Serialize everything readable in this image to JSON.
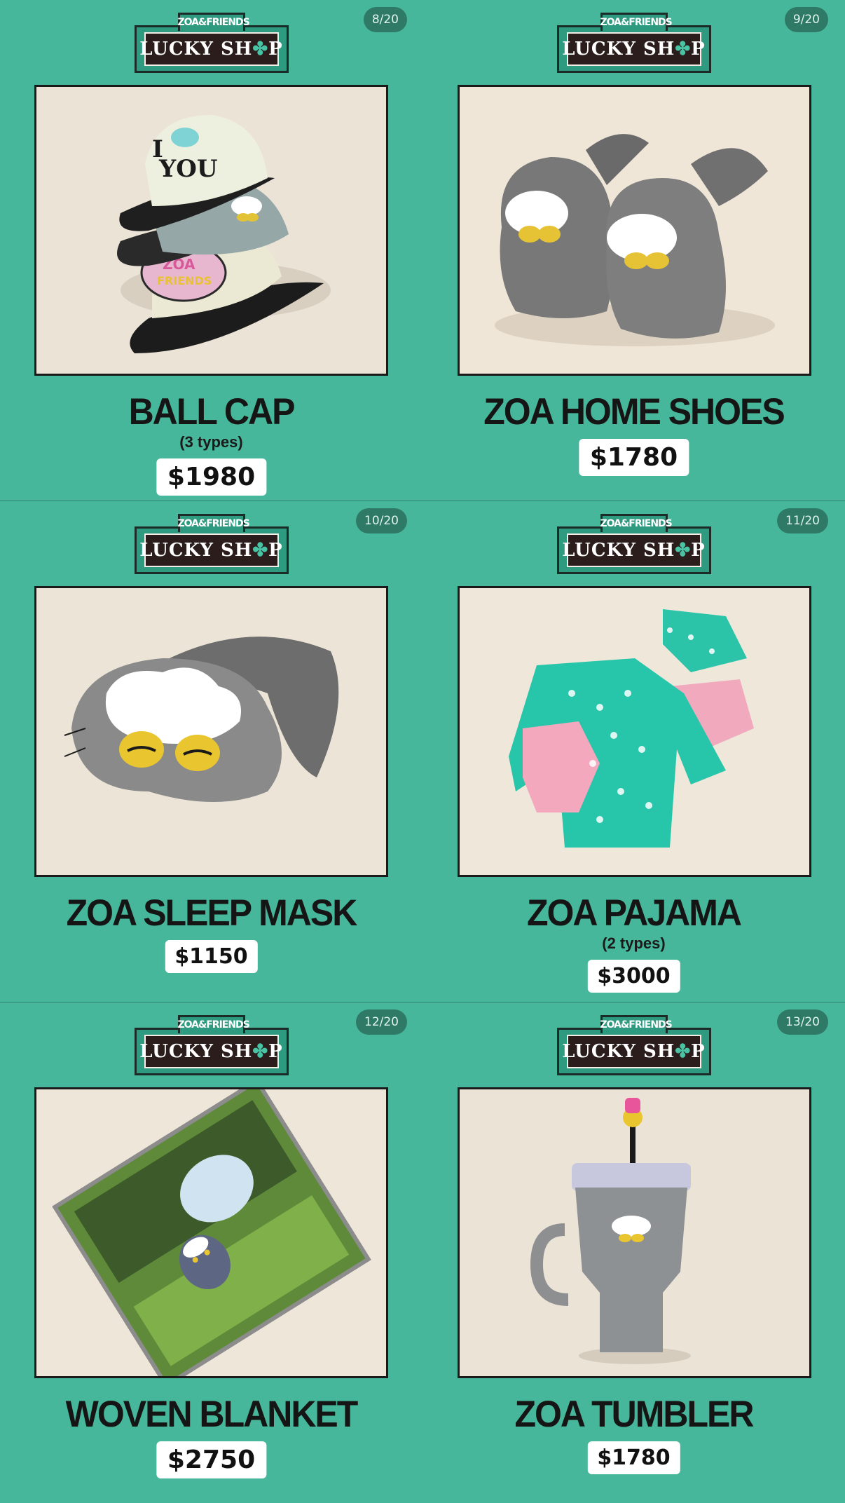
{
  "logo": {
    "sub": "ZOA&FRIENDS",
    "main_a": "LUCKY SH",
    "main_clover": "✤",
    "main_b": "P"
  },
  "items": [
    {
      "page": "8/20",
      "name": "BALL CAP",
      "types": "(3 types)",
      "price": "$1980"
    },
    {
      "page": "9/20",
      "name": "ZOA HOME SHOES",
      "types": "",
      "price": "$1780"
    },
    {
      "page": "10/20",
      "name": "ZOA SLEEP MASK",
      "types": "",
      "price": "$1150"
    },
    {
      "page": "11/20",
      "name": "ZOA PAJAMA",
      "types": "(2 types)",
      "price": "$3000"
    },
    {
      "page": "12/20",
      "name": "WOVEN BLANKET",
      "types": "",
      "price": "$2750"
    },
    {
      "page": "13/20",
      "name": "ZOA TUMBLER",
      "types": "",
      "price": "$1780"
    }
  ]
}
